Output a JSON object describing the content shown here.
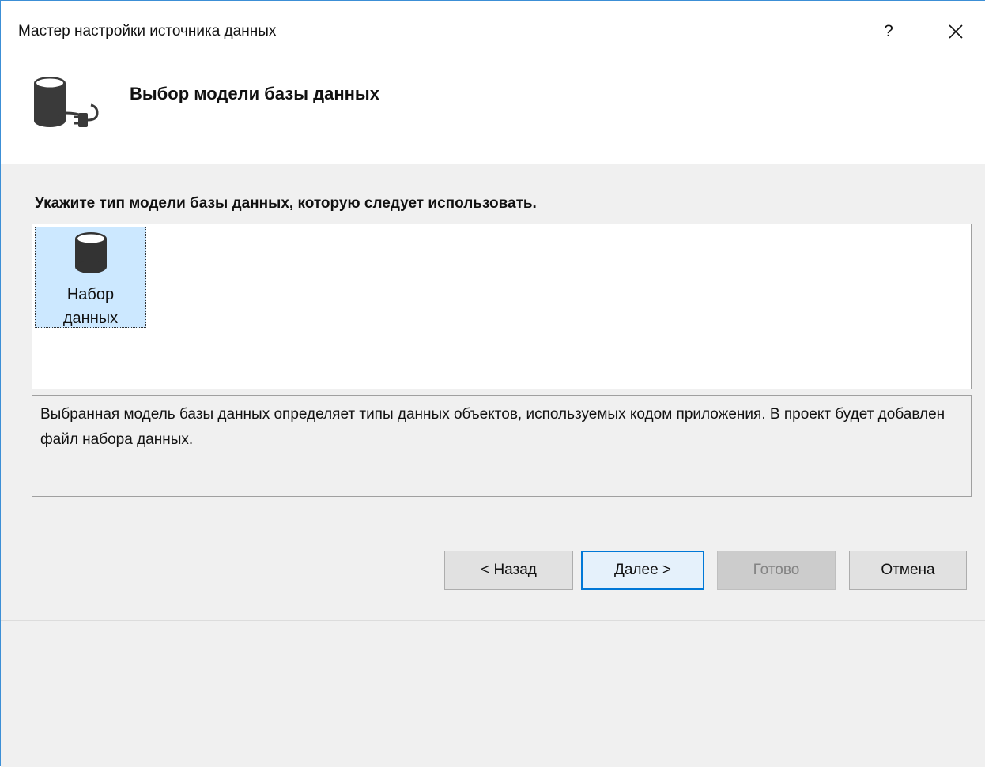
{
  "window": {
    "title": "Мастер настройки источника данных",
    "help_label": "?",
    "close_icon": "close-icon"
  },
  "header": {
    "icon": "database-plug-icon",
    "title": "Выбор модели базы данных"
  },
  "main": {
    "instruction": "Укажите тип модели базы данных, которую следует использовать.",
    "models": [
      {
        "label": "Набор\nданных",
        "icon": "database-icon",
        "selected": true
      }
    ],
    "description": "Выбранная модель базы данных определяет типы данных объектов, используемых кодом приложения. В проект будет добавлен файл набора данных."
  },
  "buttons": {
    "back": "< Назад",
    "next": "Далее >",
    "finish": "Готово",
    "cancel": "Отмена"
  },
  "colors": {
    "accent": "#0078d7",
    "selection": "#cce8ff",
    "panel_bg": "#f0f0f0"
  }
}
